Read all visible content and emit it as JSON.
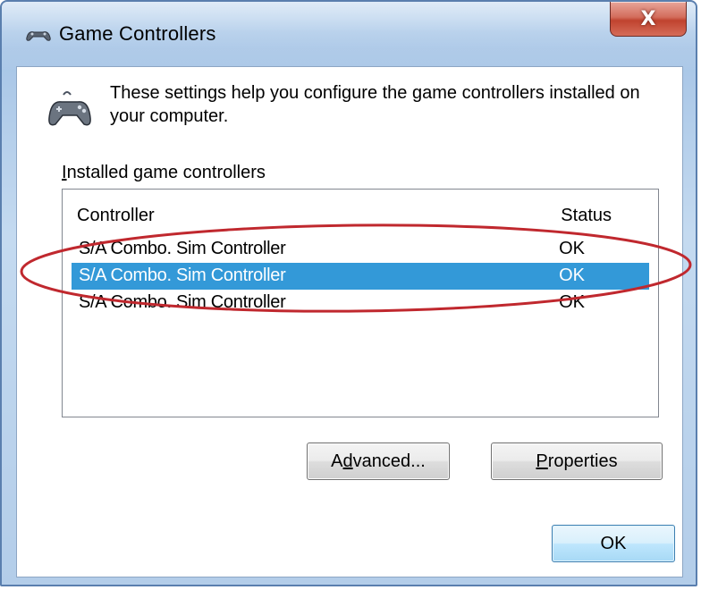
{
  "window": {
    "title": "Game Controllers",
    "close_glyph": "X"
  },
  "header": {
    "description": "These settings help you configure the game controllers installed on your computer."
  },
  "group": {
    "label_prefix": "I",
    "label_rest": "nstalled game controllers"
  },
  "list": {
    "columns": {
      "controller": "Controller",
      "status": "Status"
    },
    "rows": [
      {
        "name": "S/A Combo. Sim Controller",
        "status": "OK"
      },
      {
        "name": "S/A Combo. Sim Controller",
        "status": "OK"
      },
      {
        "name": "S/A Combo. Sim Controller",
        "status": "OK"
      }
    ],
    "selected_index": 1
  },
  "buttons": {
    "advanced_pre": "A",
    "advanced_acc": "d",
    "advanced_post": "vanced...",
    "properties_acc": "P",
    "properties_post": "roperties",
    "ok": "OK"
  },
  "colors": {
    "selection": "#3399d8",
    "annotation_ellipse": "#c0282e"
  },
  "icons": {
    "title_icon": "gamepad-icon",
    "header_icon": "gamepad-large-icon"
  }
}
